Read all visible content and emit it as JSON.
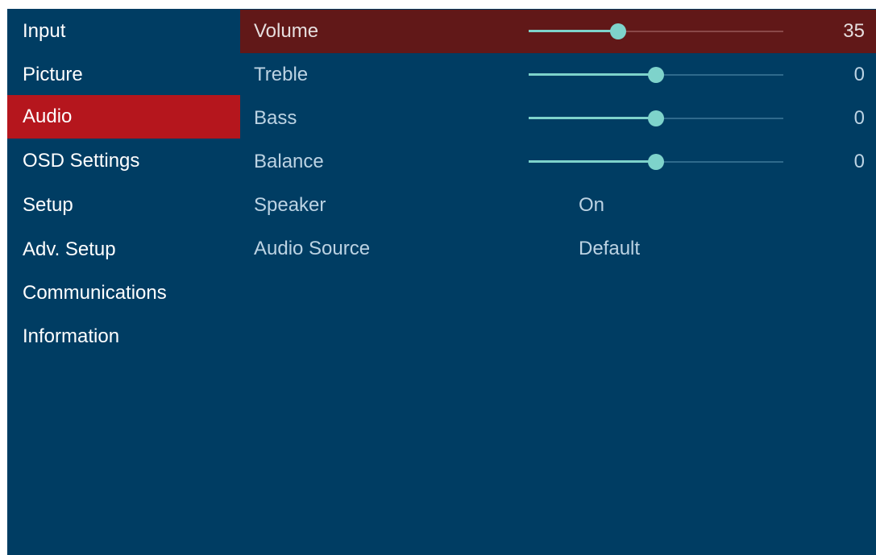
{
  "menu": {
    "items": [
      {
        "label": "Input"
      },
      {
        "label": "Picture"
      },
      {
        "label": "Audio"
      },
      {
        "label": "OSD Settings"
      },
      {
        "label": "Setup"
      },
      {
        "label": "Adv. Setup"
      },
      {
        "label": "Communications"
      },
      {
        "label": "Information"
      }
    ],
    "active_index": 2
  },
  "audio": {
    "selected_index": 0,
    "rows": [
      {
        "label": "Volume",
        "type": "slider",
        "value": "35",
        "level": 0.35
      },
      {
        "label": "Treble",
        "type": "slider",
        "value": "0",
        "level": 0.5
      },
      {
        "label": "Bass",
        "type": "slider",
        "value": "0",
        "level": 0.5
      },
      {
        "label": "Balance",
        "type": "slider",
        "value": "0",
        "level": 0.5
      },
      {
        "label": "Speaker",
        "type": "option",
        "value": "On"
      },
      {
        "label": "Audio Source",
        "type": "option",
        "value": "Default"
      }
    ]
  },
  "colors": {
    "background": "#003d63",
    "active_menu": "#b5161d",
    "selected_row": "#611818",
    "slider_fill": "#7ed3cb"
  }
}
